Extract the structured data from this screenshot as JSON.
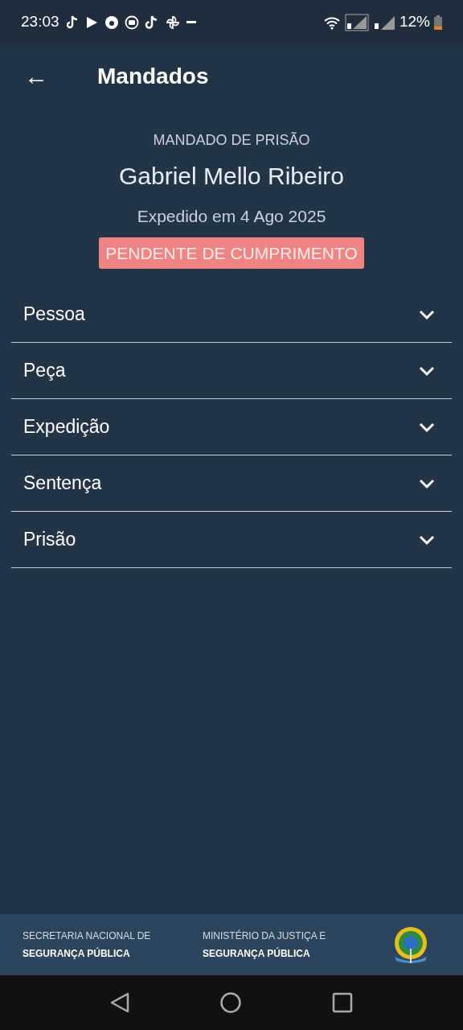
{
  "status_bar": {
    "time": "23:03",
    "battery": "12%"
  },
  "app_bar": {
    "back": "←",
    "title": "Mandados"
  },
  "header": {
    "type": "MANDADO DE PRISÃO",
    "name": "Gabriel Mello Ribeiro",
    "issued": "Expedido em 4 Ago 2025",
    "status": "PENDENTE DE CUMPRIMENTO"
  },
  "sections": [
    {
      "label": "Pessoa",
      "expanded": false
    },
    {
      "label": "Peça",
      "expanded": false
    },
    {
      "label": "Expedição",
      "expanded": false
    },
    {
      "label": "Sentença",
      "expanded": false
    },
    {
      "label": "Prisão",
      "expanded": false
    }
  ],
  "footer": [
    {
      "line_1": "SECRETARIA NACIONAL DE",
      "line_2": "SEGURANÇA PÚBLICA"
    },
    {
      "line_1": "MINISTÉRIO DA JUSTIÇA E",
      "line_2": "SEGURANÇA PÚBLICA"
    }
  ]
}
